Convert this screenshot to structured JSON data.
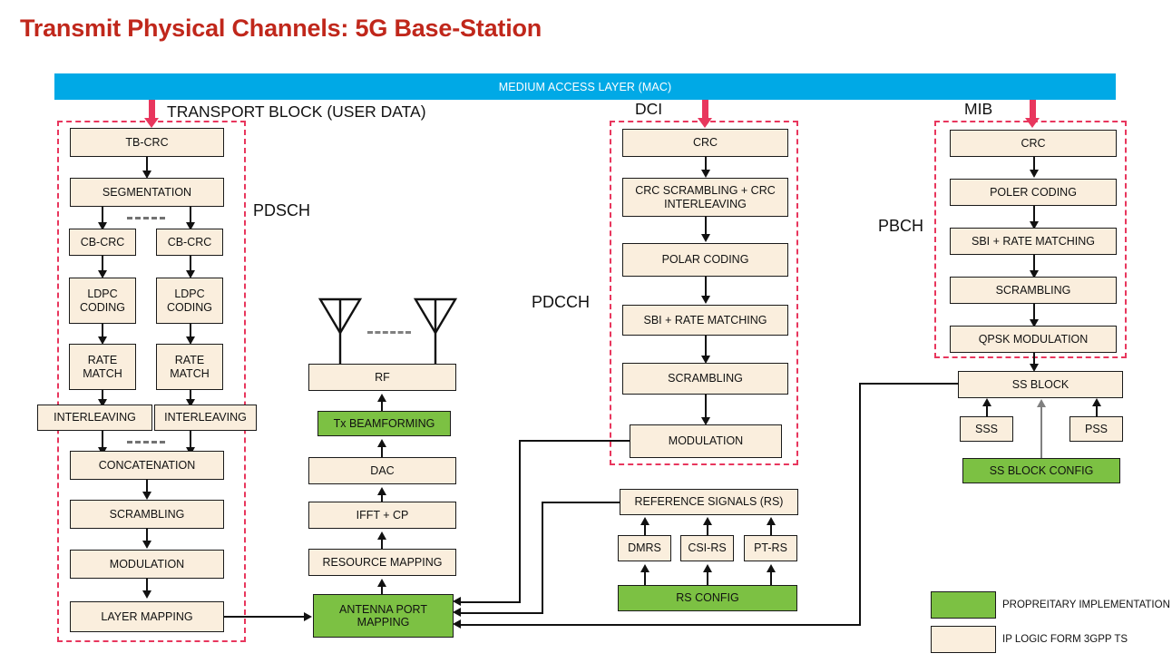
{
  "page": {
    "title": "Transmit Physical Channels: 5G Base-Station",
    "title_color": "#c0271b",
    "mac_layer": "MEDIUM ACCESS LAYER (MAC)",
    "mac_color": "#00a9e6"
  },
  "colors": {
    "ip_logic": "#faeedd",
    "proprietary": "#7cc143",
    "group_dash": "#e8365d",
    "feed_arrow": "#e8365d",
    "line": "#111111",
    "gray_line": "#808080"
  },
  "feeds": [
    {
      "label": "TRANSPORT BLOCK (USER DATA)"
    },
    {
      "label": "DCI"
    },
    {
      "label": "MIB"
    }
  ],
  "channels": [
    {
      "name": "PDSCH"
    },
    {
      "name": "PDCCH"
    },
    {
      "name": "PBCH"
    }
  ],
  "pdsch": {
    "tb_crc": "TB-CRC",
    "segmentation": "SEGMENTATION",
    "cb_crc_1": "CB-CRC",
    "cb_crc_2": "CB-CRC",
    "ldpc_1": "LDPC CODING",
    "ldpc_2": "LDPC CODING",
    "rate_match_1": "RATE MATCH",
    "rate_match_2": "RATE MATCH",
    "interleaving_1": "INTERLEAVING",
    "interleaving_2": "INTERLEAVING",
    "concatenation": "CONCATENATION",
    "scrambling": "SCRAMBLING",
    "modulation": "MODULATION",
    "layer_mapping": "LAYER MAPPING"
  },
  "pdcch": {
    "crc": "CRC",
    "crc_scrambling": "CRC SCRAMBLING + CRC INTERLEAVING",
    "polar_coding": "POLAR CODING",
    "sbi_rate_matching": "SBI + RATE MATCHING",
    "scrambling": "SCRAMBLING",
    "modulation": "MODULATION"
  },
  "pbch": {
    "crc": "CRC",
    "poler_coding": "POLER CODING",
    "sbi_rate_matching": "SBI + RATE MATCHING",
    "scrambling": "SCRAMBLING",
    "qpsk_modulation": "QPSK MODULATION",
    "ss_block": "SS BLOCK",
    "sss": "SSS",
    "pss": "PSS",
    "ss_block_config": "SS BLOCK CONFIG"
  },
  "reference_signals": {
    "rs": "REFERENCE SIGNALS (RS)",
    "dmrs": "DMRS",
    "csi_rs": "CSI-RS",
    "pt_rs": "PT-RS",
    "rs_config": "RS CONFIG"
  },
  "rf_chain": {
    "rf": "RF",
    "tx_beamforming": "Tx BEAMFORMING",
    "dac": "DAC",
    "ifft_cp": "IFFT + CP",
    "resource_mapping": "RESOURCE MAPPING",
    "antenna_port_mapping": "ANTENNA PORT MAPPING"
  },
  "legend": [
    {
      "swatch": "#7cc143",
      "label": "PROPREITARY IMPLEMENTATION"
    },
    {
      "swatch": "#faeedd",
      "label": "IP LOGIC FORM  3GPP TS"
    }
  ]
}
